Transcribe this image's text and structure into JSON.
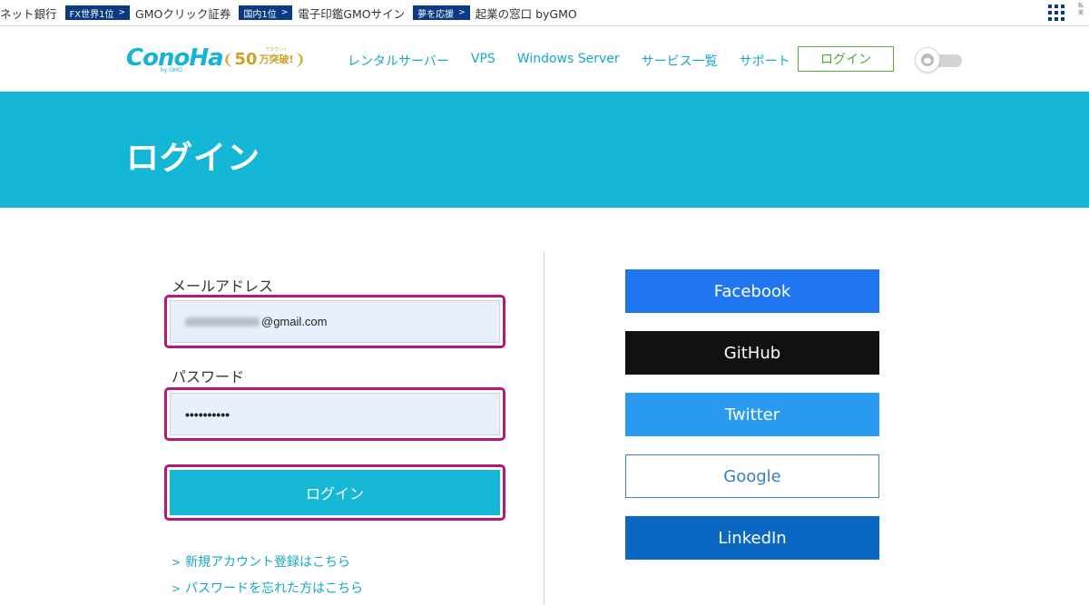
{
  "gmo_bar": {
    "items": [
      {
        "text": "ネット銀行"
      },
      {
        "badge": "FX世界1位",
        "text": "GMOクリック証券"
      },
      {
        "badge": "国内1位",
        "text": "電子印鑑GMOサイン"
      },
      {
        "badge": "夢を応援",
        "text": "起業の窓口 byGMO"
      }
    ],
    "badge_arrow": ">",
    "corner_text": "私\n実"
  },
  "header": {
    "logo_text": "ConoHa",
    "logo_sub": "by GMO",
    "award": {
      "number": "50",
      "unit": "万突破!",
      "small": "アカウント"
    },
    "nav": [
      "レンタルサーバー",
      "VPS",
      "Windows Server",
      "サービス一覧",
      "サポート"
    ],
    "login_label": "ログイン"
  },
  "hero": {
    "title": "ログイン"
  },
  "form": {
    "email_label": "メールアドレス",
    "email_value_visible": "@gmail.com",
    "password_label": "パスワード",
    "password_value": "••••••••••",
    "submit_label": "ログイン",
    "links": [
      "新規アカウント登録はこちら",
      "パスワードを忘れた方はこちら"
    ],
    "link_chevron": ">"
  },
  "sso": {
    "facebook": "Facebook",
    "github": "GitHub",
    "twitter": "Twitter",
    "google": "Google",
    "linkedin": "LinkedIn"
  },
  "colors": {
    "accent": "#14b7d6",
    "highlight_border": "#b5177a",
    "gmo_badge": "#0b3a82",
    "login_outline": "#52a83b"
  }
}
